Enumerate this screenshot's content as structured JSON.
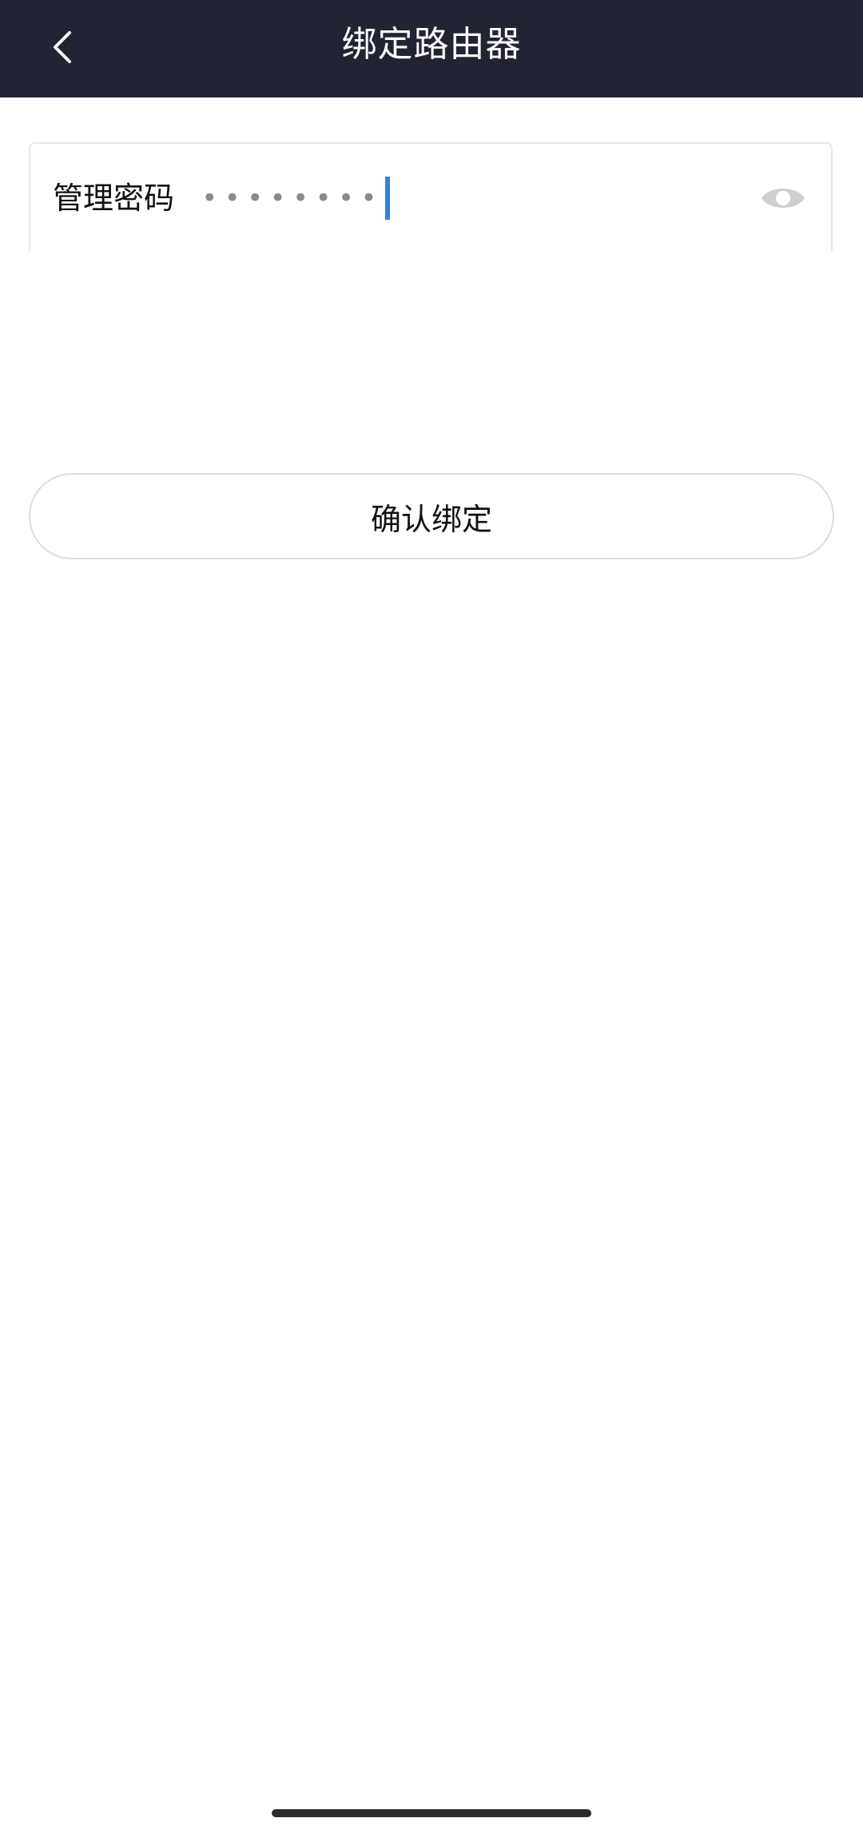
{
  "header": {
    "title": "绑定路由器",
    "back_icon": "chevron-left-icon",
    "background_color": "#222433"
  },
  "password_field": {
    "label": "管理密码",
    "masked_value": "••••••••",
    "visibility_icon": "eye-icon",
    "caret_color": "#3a7ddc"
  },
  "actions": {
    "confirm_label": "确认绑定"
  }
}
